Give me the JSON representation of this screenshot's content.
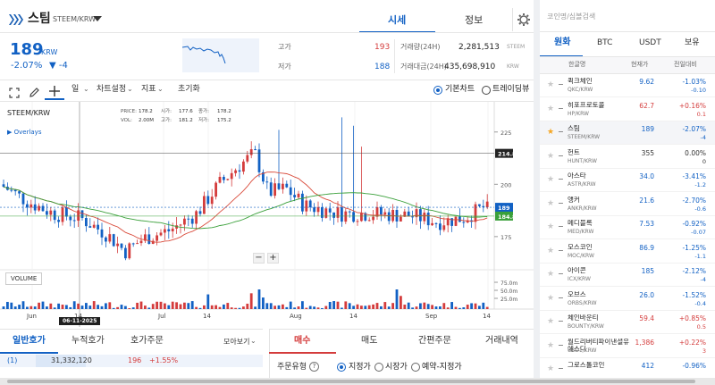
{
  "header": {
    "coin_name": "스팀",
    "pair": "STEEM/KRW",
    "tab_price": "시세",
    "tab_info": "정보"
  },
  "price": {
    "value": "189",
    "unit": "KRW",
    "change_pct": "-2.07%",
    "change_abs": "▼ -4"
  },
  "stats": {
    "high_label": "고가",
    "high": "193",
    "low_label": "저가",
    "low": "188",
    "vol_label": "거래량(24H)",
    "vol": "2,281,513",
    "vol_unit": "STEEM",
    "amt_label": "거래대금(24H)",
    "amt": "435,698,910",
    "amt_unit": "KRW"
  },
  "toolbar": {
    "interval": "일",
    "chart_settings": "차트설정",
    "indicators": "지표",
    "reset": "초기화",
    "basic_chart": "기본차트",
    "tradingview": "트레이딩뷰"
  },
  "chart": {
    "pair": "STEEM/KRW",
    "overlays": "Overlays",
    "ohlc": {
      "price_label": "PRICE:",
      "price": "178.2",
      "open_label": "시가:",
      "open": "177.6",
      "close_label": "종가:",
      "close": "178.2",
      "vol_label": "VOL:",
      "vol": "2.00M",
      "high_label": "고가:",
      "high": "181.2",
      "low_label": "저가:",
      "low": "175.2"
    },
    "volume_label": "VOLUME",
    "zoom_out": "−",
    "zoom_in": "+",
    "date_marker": "06-11-2025",
    "tag_high": "214.8",
    "tag_current": "189",
    "tag_ma": "184.8"
  },
  "chart_data": {
    "type": "candlestick",
    "y_ticks": [
      "225",
      "200",
      "175"
    ],
    "vol_ticks": [
      "75.0m",
      "50.0m",
      "25.0m"
    ],
    "x_ticks": [
      "Jun",
      "14",
      "Jul",
      "14",
      "Aug",
      "14",
      "Sep",
      "14"
    ],
    "last_price": 189,
    "ma_value": 184.8,
    "high_marker": 214.8
  },
  "orderbook": {
    "tabs": [
      "일반호가",
      "누적호가",
      "호가주문"
    ],
    "view": "모아보기",
    "row": {
      "index": "(1)",
      "qty": "31,332,120",
      "price": "196",
      "pct": "+1.55%"
    }
  },
  "order": {
    "tabs": [
      "매수",
      "매도",
      "간편주문",
      "거래내역"
    ],
    "type_label": "주문유형",
    "types": [
      "지정가",
      "시장가",
      "예약-지정가"
    ]
  },
  "sidebar": {
    "search_placeholder": "코인명/심볼검색",
    "tabs": [
      "원화",
      "BTC",
      "USDT",
      "보유"
    ],
    "col_name": "한글명",
    "col_price": "현재가",
    "col_change": "전일대비"
  },
  "coins": [
    {
      "name": "퀵크체인",
      "sym": "QKC/KRW",
      "price": "9.62",
      "pct": "-1.03%",
      "diff": "-0.10",
      "dir": "down",
      "star": false
    },
    {
      "name": "히포프로토콜",
      "sym": "HP/KRW",
      "price": "62.7",
      "pct": "+0.16%",
      "diff": "0.1",
      "dir": "up",
      "star": false
    },
    {
      "name": "스팀",
      "sym": "STEEM/KRW",
      "price": "189",
      "pct": "-2.07%",
      "diff": "-4",
      "dir": "down",
      "star": true
    },
    {
      "name": "헌트",
      "sym": "HUNT/KRW",
      "price": "355",
      "pct": "0.00%",
      "diff": "0",
      "dir": "flat",
      "star": false
    },
    {
      "name": "아스타",
      "sym": "ASTR/KRW",
      "price": "34.0",
      "pct": "-3.41%",
      "diff": "-1.2",
      "dir": "down",
      "star": false
    },
    {
      "name": "앵커",
      "sym": "ANKR/KRW",
      "price": "21.6",
      "pct": "-2.70%",
      "diff": "-0.6",
      "dir": "down",
      "star": false
    },
    {
      "name": "메디블록",
      "sym": "MED/KRW",
      "price": "7.53",
      "pct": "-0.92%",
      "diff": "-0.07",
      "dir": "down",
      "star": false
    },
    {
      "name": "모스코인",
      "sym": "MOC/KRW",
      "price": "86.9",
      "pct": "-1.25%",
      "diff": "-1.1",
      "dir": "down",
      "star": false
    },
    {
      "name": "아이콘",
      "sym": "ICX/KRW",
      "price": "185",
      "pct": "-2.12%",
      "diff": "-4",
      "dir": "down",
      "star": false
    },
    {
      "name": "오브스",
      "sym": "ORBS/KRW",
      "price": "26.0",
      "pct": "-1.52%",
      "diff": "-0.4",
      "dir": "down",
      "star": false
    },
    {
      "name": "체인바운티",
      "sym": "BOUNTY/KRW",
      "price": "59.4",
      "pct": "+0.85%",
      "diff": "0.5",
      "dir": "up",
      "star": false
    },
    {
      "name": "월드리버티파이낸셜유에스디",
      "sym": "USD1/KRW",
      "price": "1,386",
      "pct": "+0.22%",
      "diff": "3",
      "dir": "up",
      "star": false
    },
    {
      "name": "그로스톨코인",
      "sym": "",
      "price": "412",
      "pct": "-0.96%",
      "diff": "",
      "dir": "down",
      "star": false
    }
  ],
  "colors": {
    "up": "#d43c3c",
    "down": "#1261c4",
    "accent": "#1261c4",
    "ma_green": "#3aa03a",
    "ma_red": "#d94a3a"
  }
}
